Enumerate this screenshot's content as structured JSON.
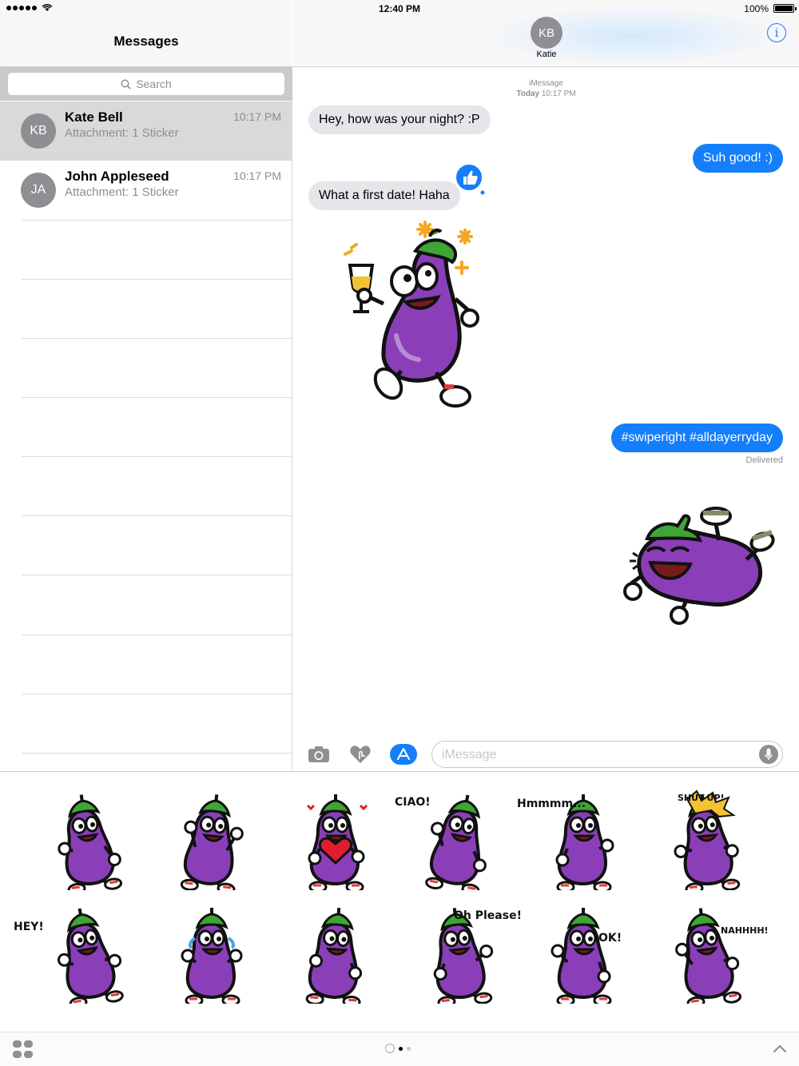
{
  "status_bar": {
    "time": "12:40 PM",
    "battery": "100%"
  },
  "sidebar": {
    "title": "Messages",
    "search_placeholder": "Search",
    "conversations": [
      {
        "initials": "KB",
        "name": "Kate Bell",
        "preview": "Attachment: 1 Sticker",
        "time": "10:17 PM",
        "selected": true
      },
      {
        "initials": "JA",
        "name": "John Appleseed",
        "preview": "Attachment: 1 Sticker",
        "time": "10:17 PM",
        "selected": false
      }
    ]
  },
  "chat": {
    "contact": {
      "initials": "KB",
      "name": "Katie"
    },
    "service_label": "iMessage",
    "timestamp_day": "Today",
    "timestamp_time": "10:17 PM",
    "messages": [
      {
        "from": "them",
        "text": "Hey, how was your night? :P"
      },
      {
        "from": "me",
        "text": "Suh good! :)"
      },
      {
        "from": "them",
        "text": "What a first date! Haha",
        "tapback": "thumbs-up"
      },
      {
        "from": "them",
        "sticker": "eggplant-wine-toast"
      },
      {
        "from": "me",
        "text": "#swiperight #alldayerryday"
      },
      {
        "from": "me",
        "sticker": "eggplant-laughing-flip"
      }
    ],
    "delivered_label": "Delivered",
    "input_placeholder": "iMessage"
  },
  "sticker_drawer": {
    "stickers": [
      {
        "name": "eggplant-dance",
        "caption": ""
      },
      {
        "name": "eggplant-wave-shy",
        "caption": ""
      },
      {
        "name": "eggplant-heart",
        "caption": ""
      },
      {
        "name": "eggplant-ciao",
        "caption": "CIAO!"
      },
      {
        "name": "eggplant-hmm",
        "caption": "Hmmmm..."
      },
      {
        "name": "eggplant-shut-up",
        "caption": "SHUT-UP!"
      },
      {
        "name": "eggplant-hey",
        "caption": "HEY!"
      },
      {
        "name": "eggplant-cry",
        "caption": ""
      },
      {
        "name": "eggplant-thumbs-up",
        "caption": ""
      },
      {
        "name": "eggplant-oh-please",
        "caption": "Oh Please!"
      },
      {
        "name": "eggplant-ok",
        "caption": "OK!"
      },
      {
        "name": "eggplant-nahhh",
        "caption": "NAHHHH!"
      }
    ],
    "page_count": 2,
    "current_page": 1
  },
  "colors": {
    "accent": "#147efb",
    "incoming_bubble": "#e5e5ea",
    "eggplant": "#8a3fb8",
    "stem": "#3fa535"
  }
}
